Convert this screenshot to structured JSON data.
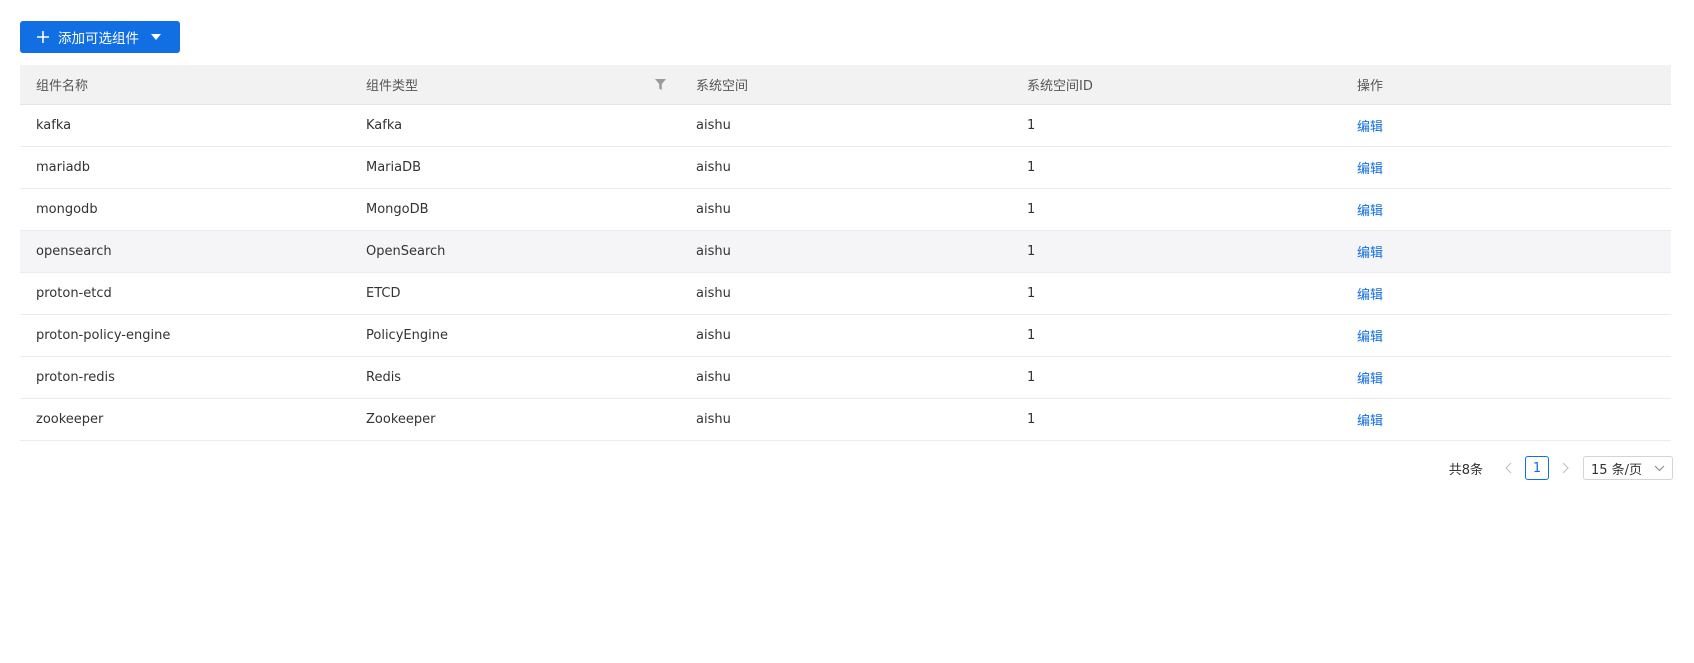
{
  "toolbar": {
    "add_button_label": "添加可选组件"
  },
  "table": {
    "headers": [
      "组件名称",
      "组件类型",
      "系统空间",
      "系统空间ID",
      "操作"
    ],
    "rows": [
      {
        "name": "kafka",
        "type": "Kafka",
        "space": "aishu",
        "space_id": "1",
        "action": "编辑"
      },
      {
        "name": "mariadb",
        "type": "MariaDB",
        "space": "aishu",
        "space_id": "1",
        "action": "编辑"
      },
      {
        "name": "mongodb",
        "type": "MongoDB",
        "space": "aishu",
        "space_id": "1",
        "action": "编辑"
      },
      {
        "name": "opensearch",
        "type": "OpenSearch",
        "space": "aishu",
        "space_id": "1",
        "action": "编辑"
      },
      {
        "name": "proton-etcd",
        "type": "ETCD",
        "space": "aishu",
        "space_id": "1",
        "action": "编辑"
      },
      {
        "name": "proton-policy-engine",
        "type": "PolicyEngine",
        "space": "aishu",
        "space_id": "1",
        "action": "编辑"
      },
      {
        "name": "proton-redis",
        "type": "Redis",
        "space": "aishu",
        "space_id": "1",
        "action": "编辑"
      },
      {
        "name": "zookeeper",
        "type": "Zookeeper",
        "space": "aishu",
        "space_id": "1",
        "action": "编辑"
      }
    ]
  },
  "pagination": {
    "total": "共8条",
    "current_page": "1",
    "page_size": "15 条/页"
  },
  "colors": {
    "accent": "#126ee3",
    "header_bg": "#f2f2f3",
    "hover_row_bg": "#f5f5f7"
  },
  "icons": {
    "add": "plus-icon",
    "dropdown": "caret-down-icon",
    "filter": "filter-icon",
    "prev": "chevron-left-icon",
    "next": "chevron-right-icon",
    "select": "chevron-down-icon"
  }
}
